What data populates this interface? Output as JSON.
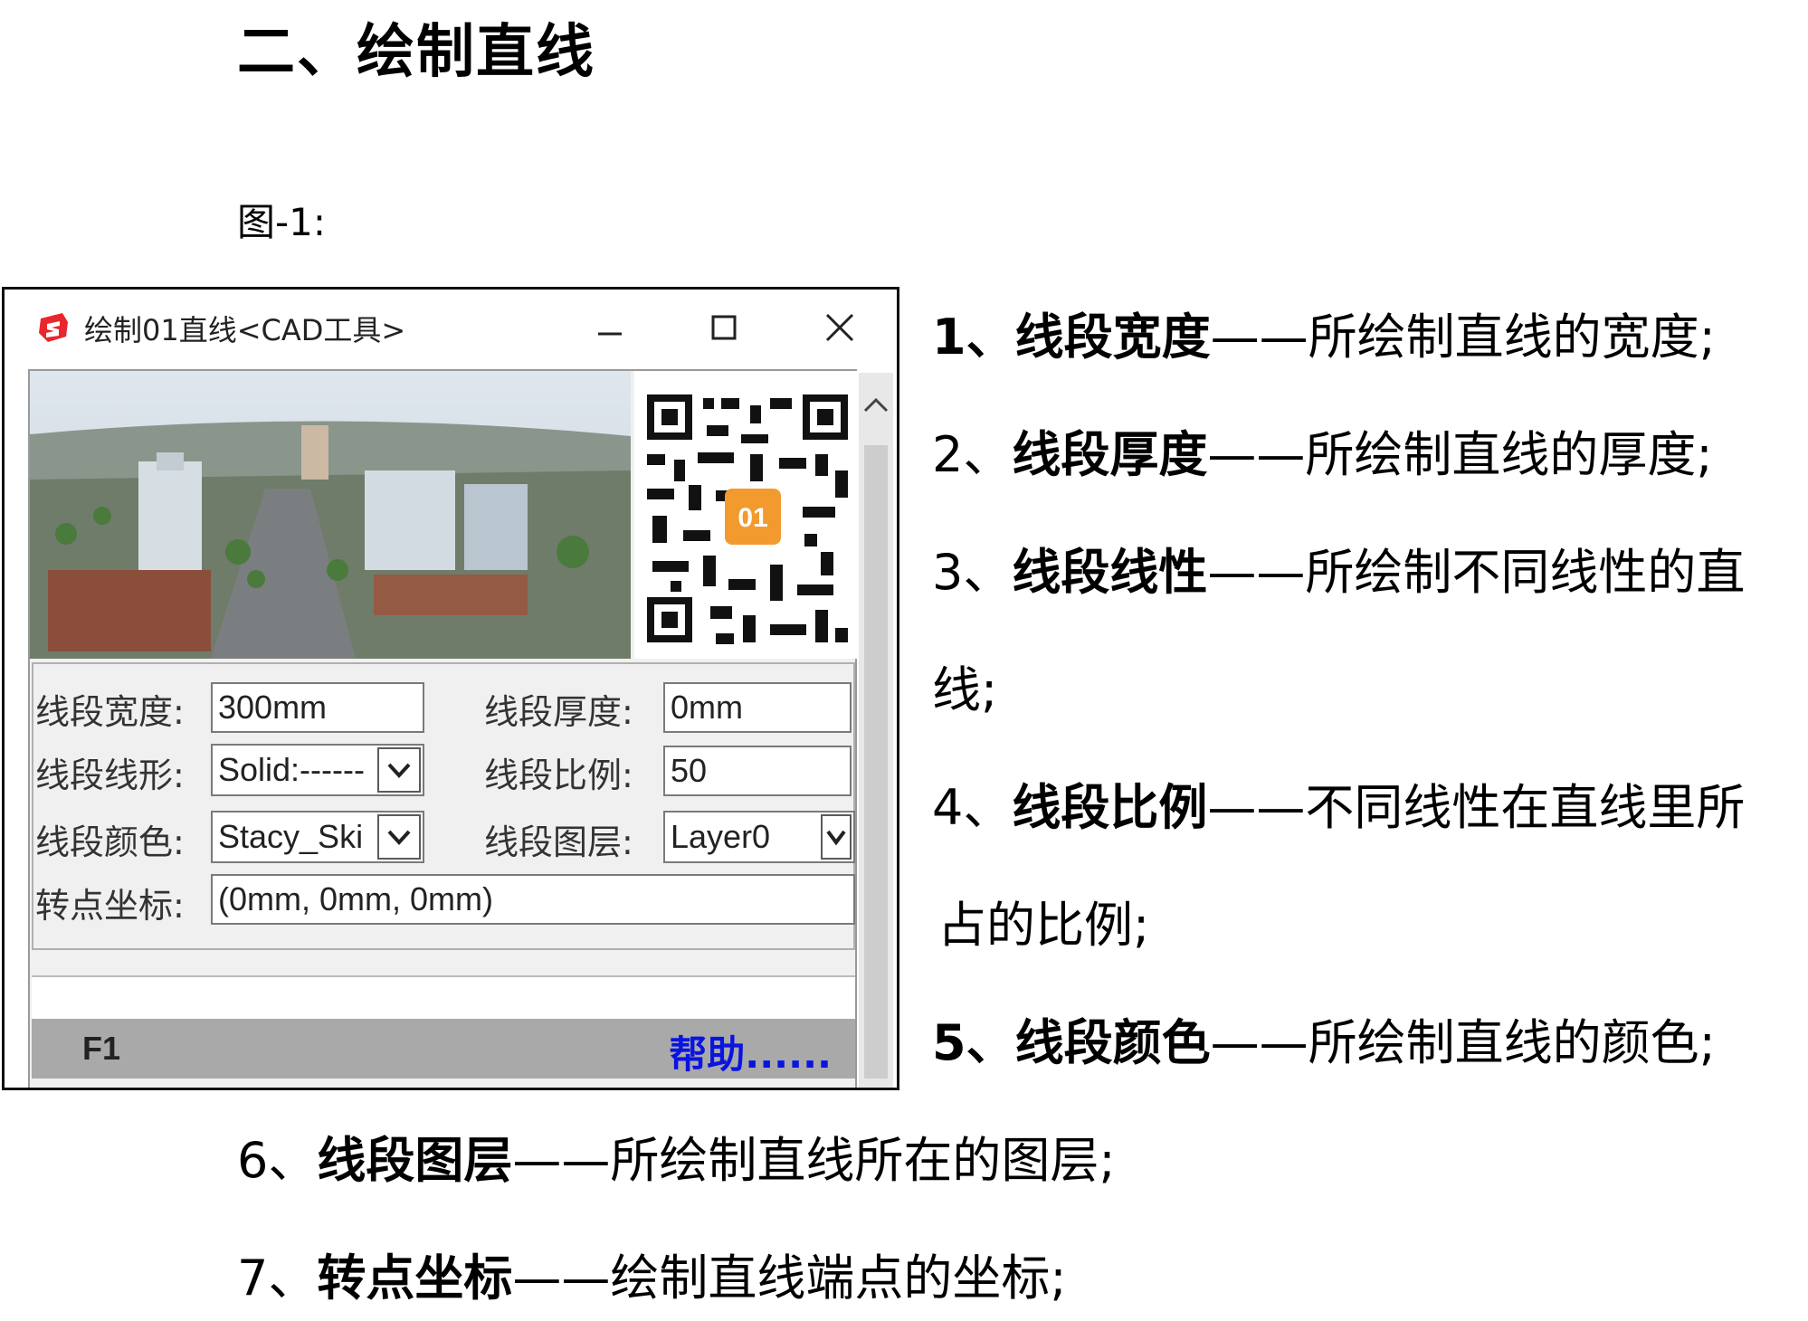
{
  "heading": "二、绘制直线",
  "figure_label": "图-1:",
  "dialog": {
    "title": "绘制01直线<CAD工具>",
    "window_buttons": {
      "minimize": "—",
      "maximize": "☐",
      "close": "✕"
    },
    "qr_badge": "01",
    "fields": {
      "width_label": "线段宽度:",
      "width_value": "300mm",
      "thickness_label": "线段厚度:",
      "thickness_value": "0mm",
      "linetype_label": "线段线形:",
      "linetype_value": "Solid:------",
      "scale_label": "线段比例:",
      "scale_value": "50",
      "color_label": "线段颜色:",
      "color_value": "Stacy_Ski",
      "layer_label": "线段图层:",
      "layer_value": "Layer0",
      "coord_label": "转点坐标:",
      "coord_value": "(0mm, 0mm, 0mm)"
    },
    "status": {
      "f1": "F1",
      "help": "帮助......"
    },
    "colors": {
      "help_link": "#0a14e0",
      "status_bar": "#a9a9a9",
      "icon_red": "#e8262b"
    },
    "icons": [
      "sketchup-logo-icon",
      "minimize-icon",
      "maximize-icon",
      "close-icon",
      "chevron-down-icon",
      "scroll-up-icon"
    ]
  },
  "items": [
    {
      "num": "1、",
      "term": "线段宽度",
      "dash": "——",
      "desc": "所绘制直线的宽度;"
    },
    {
      "num": "2、",
      "term": "线段厚度",
      "dash": "——",
      "desc": "所绘制直线的厚度;"
    },
    {
      "num": "3、",
      "term": "线段线性",
      "dash": "——",
      "desc": "所绘制不同线性的直",
      "cont": "线;"
    },
    {
      "num": "4、",
      "term": "线段比例",
      "dash": "——",
      "desc": "不同线性在直线里所",
      "cont": "占的比例;"
    },
    {
      "num": "5、",
      "term": "线段颜色",
      "dash": "——",
      "desc": "所绘制直线的颜色;"
    },
    {
      "num": "6、",
      "term": "线段图层",
      "dash": "——",
      "desc": "所绘制直线所在的图层;"
    },
    {
      "num": "7、",
      "term": "转点坐标",
      "dash": "——",
      "desc": "绘制直线端点的坐标;"
    }
  ]
}
